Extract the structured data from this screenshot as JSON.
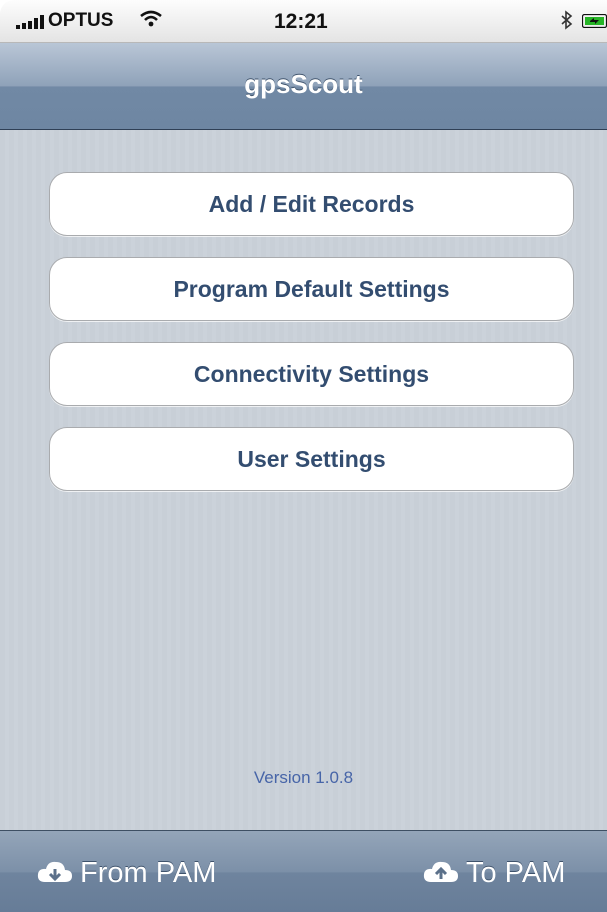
{
  "status_bar": {
    "carrier": "OPTUS",
    "time": "12:21"
  },
  "nav": {
    "title": "gpsScout"
  },
  "menu": {
    "items": [
      {
        "label": "Add / Edit Records"
      },
      {
        "label": "Program Default Settings"
      },
      {
        "label": "Connectivity Settings"
      },
      {
        "label": "User Settings"
      }
    ]
  },
  "footer": {
    "version": "Version 1.0.8"
  },
  "toolbar": {
    "from_label": "From PAM",
    "to_label": "To PAM"
  },
  "icons": {
    "signal": "signal-bars-icon",
    "wifi": "wifi-icon",
    "bluetooth": "bluetooth-icon",
    "battery": "battery-charging-icon",
    "download": "cloud-download-icon",
    "upload": "cloud-upload-icon"
  },
  "colors": {
    "nav_bar": "#8fa2b9",
    "button_text": "#334d70",
    "version_text": "#4765a8",
    "toolbar": "#7c90a8"
  }
}
